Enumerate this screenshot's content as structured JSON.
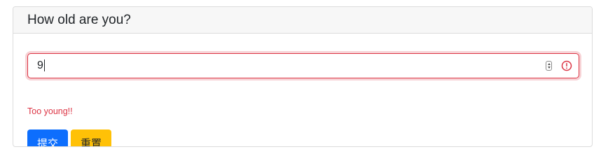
{
  "card": {
    "title": "How old are you?"
  },
  "age_field": {
    "value": "9",
    "input_type": "number"
  },
  "validation": {
    "message": "Too young!!",
    "error_color": "#dc3545"
  },
  "buttons": {
    "submit_label": "提交",
    "reset_label": "重置",
    "submit_color": "#0d6efd",
    "reset_color": "#ffc107"
  },
  "icons": {
    "invalid": "exclamation-circle-icon",
    "spinner": "number-spinner-icon"
  }
}
